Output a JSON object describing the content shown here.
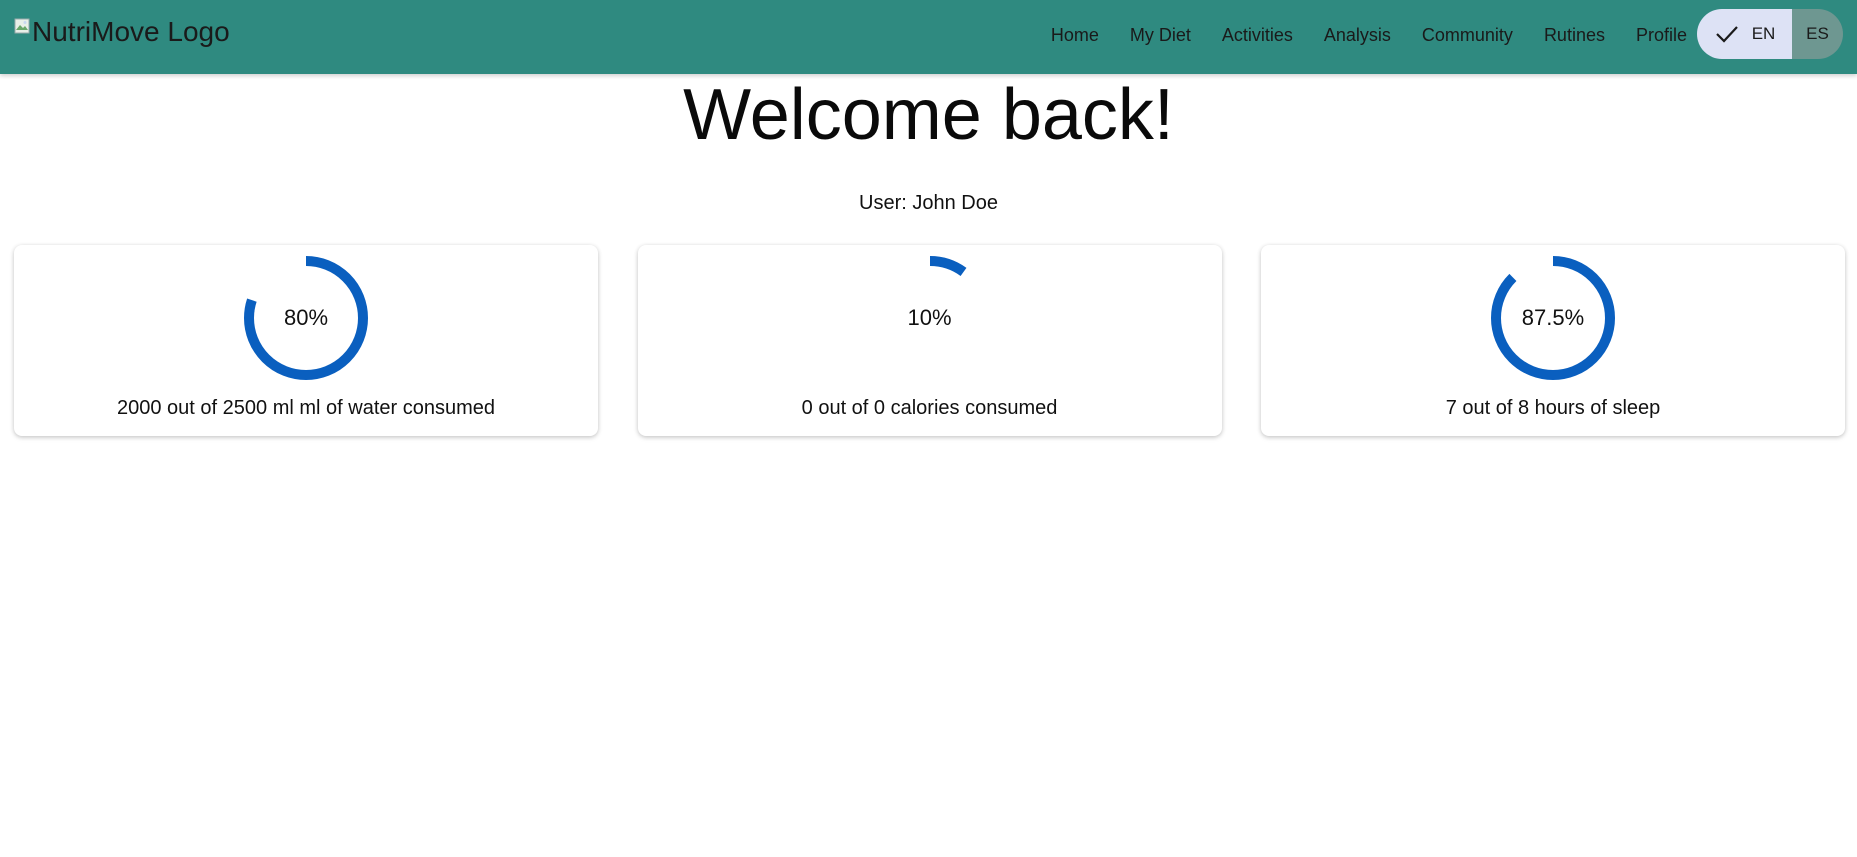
{
  "header": {
    "logo_alt": "NutriMove Logo",
    "nav": [
      "Home",
      "My Diet",
      "Activities",
      "Analysis",
      "Community",
      "Rutines",
      "Profile"
    ],
    "language": {
      "options": [
        "EN",
        "ES"
      ],
      "selected": "EN"
    },
    "colors": {
      "bar": "#2f8a80",
      "lang_selected": "#dde2f5",
      "lang_unselected": "#6e9791"
    }
  },
  "main": {
    "title": "Welcome back!",
    "user_line": "User: John Doe",
    "cards": [
      {
        "percent_label": "80%",
        "progress": 0.8,
        "caption": "2000 out of 2500 ml ml of water consumed"
      },
      {
        "percent_label": "10%",
        "progress": 0.1,
        "caption": "0 out of 0 calories consumed"
      },
      {
        "percent_label": "87.5%",
        "progress": 0.875,
        "caption": "7 out of 8 hours of sleep"
      }
    ],
    "ring_color": "#0a5fbf"
  }
}
